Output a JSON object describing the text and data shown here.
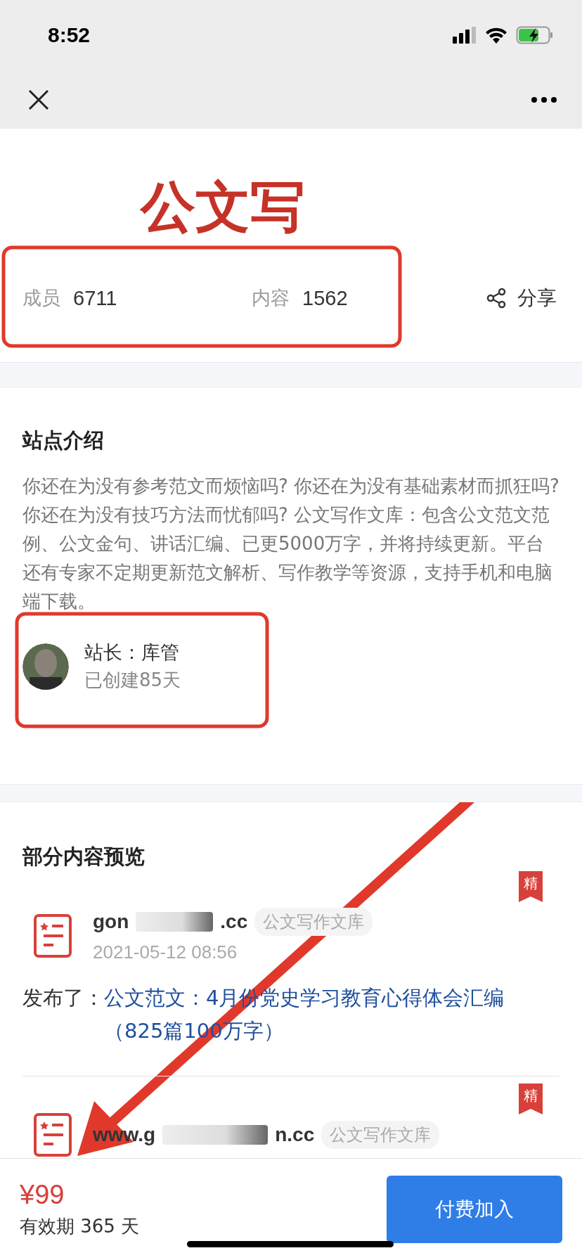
{
  "status_bar": {
    "time": "8:52"
  },
  "banner": {
    "title": "公文写"
  },
  "stats": [
    {
      "label": "成员",
      "value": "6711"
    },
    {
      "label": "内容",
      "value": "1562"
    }
  ],
  "share": {
    "label": "分享"
  },
  "intro": {
    "heading": "站点介绍",
    "text": "你还在为没有参考范文而烦恼吗? 你还在为没有基础素材而抓狂吗? 你还在为没有技巧方法而忧郁吗? 公文写作文库：包含公文范文范例、公文金句、讲话汇编、已更5000万字，并将持续更新。平台还有专家不定期更新范文解析、写作教学等资源，支持手机和电脑端下载。",
    "owner": {
      "name": "站长：库管",
      "created": "已创建85天"
    }
  },
  "preview": {
    "heading": "部分内容预览",
    "posts": [
      {
        "author_start": "gon",
        "author_end": ".cc",
        "tag": "公文写作文库",
        "date": "2021-05-12 08:56",
        "prefix": "发布了：",
        "title": "公文范文：4月份党史学习教育心得体会汇编（825篇100万字）",
        "featured": true,
        "featured_label": "精"
      },
      {
        "author_start": "www.g",
        "author_end": "n.cc",
        "tag": "公文写作文库",
        "featured": true,
        "featured_label": "精"
      }
    ]
  },
  "footer": {
    "price": "¥99",
    "validity": "有效期 365 天",
    "button": "付费加入"
  }
}
